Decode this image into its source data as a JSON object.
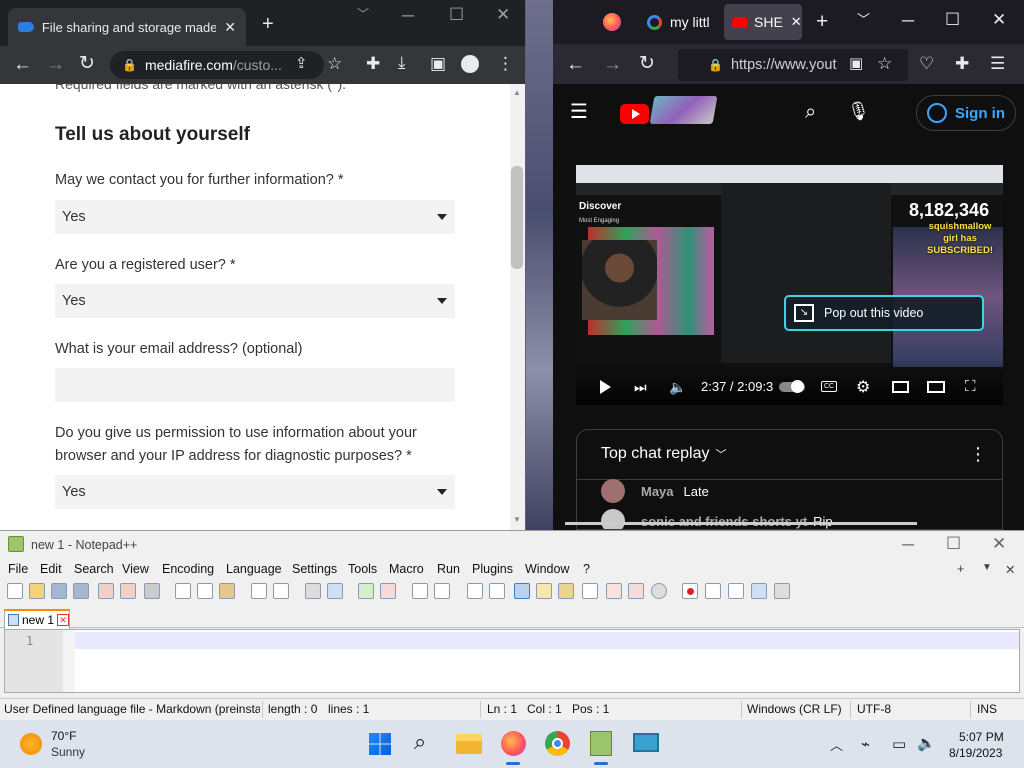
{
  "chrome": {
    "tab_title": "File sharing and storage made si",
    "url_host": "mediafire.com",
    "url_path": "/custo...",
    "form": {
      "required_note": "Required fields are marked with an asterisk (*).",
      "heading": "Tell us about yourself",
      "q1": "May we contact you for further information? *",
      "a1": "Yes",
      "q2": "Are you a registered user? *",
      "a2": "Yes",
      "q3": "What is your email address? (optional)",
      "email_value": "",
      "q4": "Do you give us permission to use information about your browser and your IP address for diagnostic purposes? *",
      "a4": "Yes"
    }
  },
  "firefox": {
    "tab1_title": "my littl",
    "tab2_title": "SHE",
    "url": "https://www.yout",
    "youtube": {
      "sign_in": "Sign in",
      "video": {
        "discover": "Discover",
        "most_engaging": "Most Engaging",
        "count": "8,182,346",
        "subscribed_text": "squishmallow girl has SUBSCRIBED!",
        "popout": "Pop out this video",
        "time": "2:37 / 2:09:3"
      },
      "chat": {
        "title": "Top chat replay",
        "messages": [
          {
            "author": "Maya",
            "text": "Late"
          },
          {
            "author": "sonic and friends shorts yt",
            "text": "Rip"
          }
        ]
      }
    }
  },
  "notepad": {
    "title": "new 1 - Notepad++",
    "menu": [
      "File",
      "Edit",
      "Search",
      "View",
      "Encoding",
      "Language",
      "Settings",
      "Tools",
      "Macro",
      "Run",
      "Plugins",
      "Window",
      "?"
    ],
    "tab": "new 1",
    "line_number": "1",
    "status": {
      "lang": "User Defined language file - Markdown (preinstal",
      "length": "length : 0",
      "lines": "lines : 1",
      "ln": "Ln : 1",
      "col": "Col : 1",
      "pos": "Pos : 1",
      "eol": "Windows (CR LF)",
      "encoding": "UTF-8",
      "mode": "INS"
    }
  },
  "taskbar": {
    "temp": "70°F",
    "weather": "Sunny",
    "time": "5:07 PM",
    "date": "8/19/2023"
  },
  "colors": {
    "youtube_red": "#ff0000",
    "signin_blue": "#3ea6ff",
    "popout_border": "#3cd5e6",
    "notepad_current_line": "#e8e8ff"
  }
}
